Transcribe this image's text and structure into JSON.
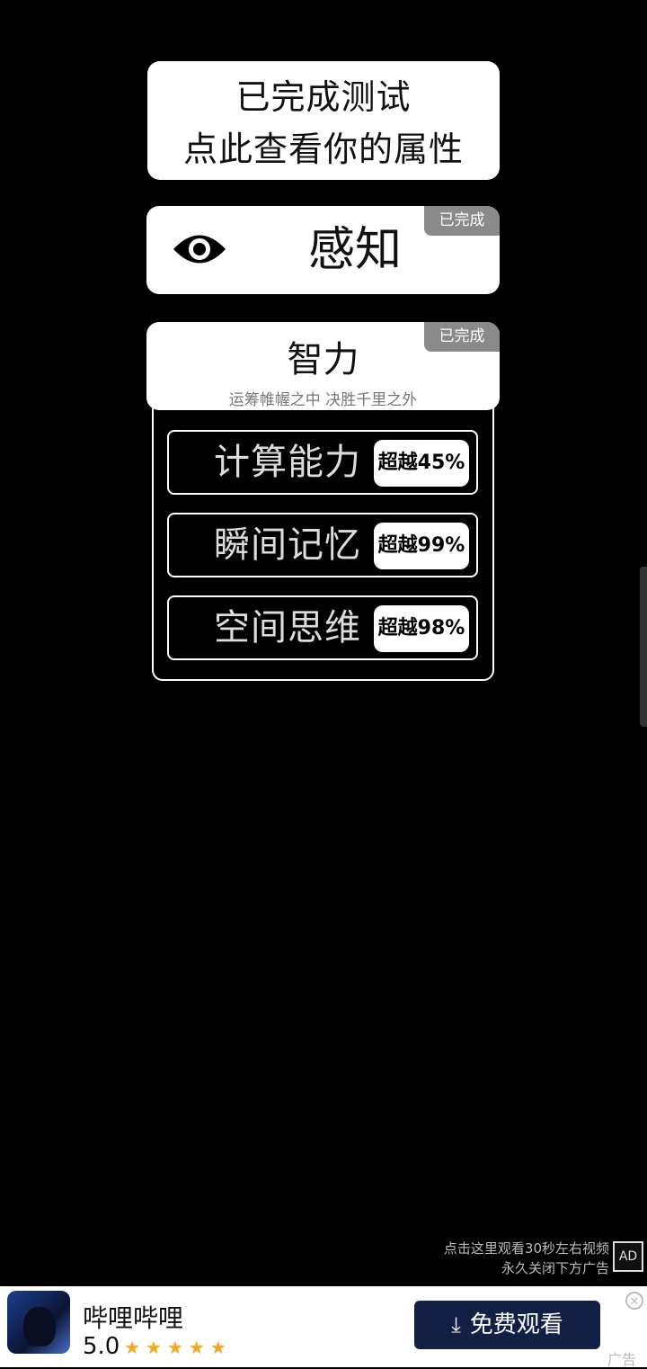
{
  "hero": {
    "line1": "已完成测试",
    "line2": "点此查看你的属性"
  },
  "perception": {
    "badge": "已完成",
    "title": "感知",
    "icon": "eye-icon"
  },
  "intelligence": {
    "badge": "已完成",
    "title": "智力",
    "subtitle": "运筹帷幄之中 决胜千里之外",
    "abilities": [
      {
        "name": "计算能力",
        "result": "超越45%"
      },
      {
        "name": "瞬间记忆",
        "result": "超越99%"
      },
      {
        "name": "空间思维",
        "result": "超越98%"
      }
    ]
  },
  "ad_hint": {
    "line1": "点击这里观看30秒左右视频",
    "line2": "永久关闭下方广告",
    "icon_label": "AD"
  },
  "ad_banner": {
    "app_name": "哔哩哔哩",
    "rating": "5.0",
    "stars": "★★★★★",
    "cta_label": "免费观看",
    "ad_label": "广告"
  }
}
